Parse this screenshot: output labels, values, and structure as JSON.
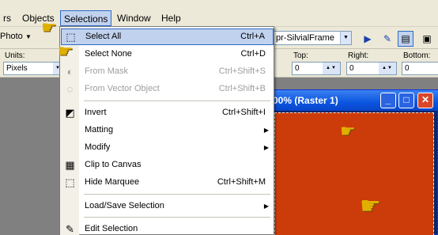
{
  "menubar": {
    "items": [
      {
        "label": "rs"
      },
      {
        "label": "Objects"
      },
      {
        "label": "Selections"
      },
      {
        "label": "Window"
      },
      {
        "label": "Help"
      }
    ]
  },
  "toolbar": {
    "tool_label": "Photo",
    "preset_value": "pr-SilvialFrame"
  },
  "options": {
    "units_label": "Units:",
    "units_value": "Pixels",
    "top_label": "Top:",
    "top_value": "0",
    "right_label": "Right:",
    "right_value": "0",
    "bottom_label": "Bottom:",
    "bottom_value": "0"
  },
  "document": {
    "title": "00% (Raster 1)",
    "canvas_color": "#cc3b0a"
  },
  "menu": {
    "items": [
      {
        "label": "Select All",
        "shortcut": "Ctrl+A",
        "icon": "select-all-icon"
      },
      {
        "label": "Select None",
        "shortcut": "Ctrl+D",
        "icon": "select-none-icon"
      },
      {
        "label": "From Mask",
        "shortcut": "Ctrl+Shift+S",
        "icon": "from-mask-icon"
      },
      {
        "label": "From Vector Object",
        "shortcut": "Ctrl+Shift+B",
        "icon": "from-vector-icon"
      },
      {
        "label": "Invert",
        "shortcut": "Ctrl+Shift+I",
        "icon": "invert-icon"
      },
      {
        "label": "Matting"
      },
      {
        "label": "Modify"
      },
      {
        "label": "Clip to Canvas",
        "icon": "clip-canvas-icon"
      },
      {
        "label": "Hide Marquee",
        "shortcut": "Ctrl+Shift+M",
        "icon": "hide-marquee-icon"
      },
      {
        "label": "Load/Save Selection"
      },
      {
        "label": "Edit Selection",
        "icon": "edit-selection-icon"
      }
    ]
  },
  "colors": {
    "highlight": "#c1d2ee",
    "highlight_border": "#316ac5",
    "pointer": "#e0b000"
  }
}
